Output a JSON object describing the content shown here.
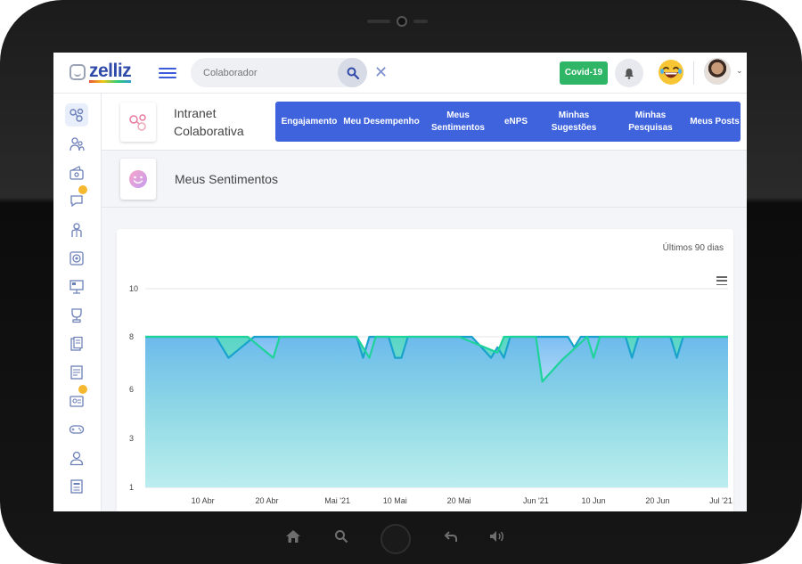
{
  "header": {
    "logo_text": "zelliz",
    "search_placeholder": "Colaborador",
    "covid_label": "Covid-19"
  },
  "app": {
    "title": "Intranet Colaborativa",
    "nav": [
      {
        "label": "Engajamento"
      },
      {
        "label": "Meu Desempenho"
      },
      {
        "label": "Meus Sentimentos"
      },
      {
        "label": "eNPS"
      },
      {
        "label": "Minhas Sugestões"
      },
      {
        "label": "Minhas Pesquisas"
      },
      {
        "label": "Meus Posts"
      }
    ]
  },
  "section": {
    "title": "Meus Sentimentos"
  },
  "sidebar_icons": [
    "network-icon",
    "people-icon",
    "wallet-icon",
    "chat-icon",
    "person-icon",
    "target-icon",
    "presentation-icon",
    "trophy-icon",
    "documents-icon",
    "form-icon",
    "id-card-icon",
    "gamepad-icon",
    "user-icon",
    "report-icon"
  ],
  "chart_data": {
    "type": "area",
    "period_label": "Últimos 90 dias",
    "x_ticks": [
      "10 Abr",
      "20 Abr",
      "Mai '21",
      "10 Mai",
      "20 Mai",
      "Jun '21",
      "10 Jun",
      "20 Jun",
      "Jul '21"
    ],
    "y_ticks": [
      "10",
      "8",
      "6",
      "3",
      "1"
    ],
    "ylim": [
      1,
      10
    ],
    "series": [
      {
        "color": "#19a3cc",
        "dates": [
          "2021-04-01",
          "2021-04-12",
          "2021-04-14",
          "2021-04-16",
          "2021-04-18",
          "2021-04-20",
          "2021-05-04",
          "2021-05-05",
          "2021-05-06",
          "2021-05-09",
          "2021-05-10",
          "2021-05-11",
          "2021-05-12",
          "2021-05-22",
          "2021-05-25",
          "2021-05-26",
          "2021-05-27",
          "2021-05-28",
          "2021-06-06",
          "2021-06-07",
          "2021-06-08",
          "2021-06-15",
          "2021-06-16",
          "2021-06-17",
          "2021-06-22",
          "2021-06-23",
          "2021-06-24",
          "2021-07-01"
        ],
        "values": [
          8,
          8,
          7.2,
          7.6,
          8,
          8,
          8,
          7.2,
          8,
          8,
          7.2,
          7.2,
          8,
          8,
          7.2,
          7.6,
          7.2,
          8,
          8,
          7.6,
          8,
          8,
          7.2,
          8,
          8,
          7.2,
          8,
          8
        ]
      },
      {
        "color": "#1ed39a",
        "dates": [
          "2021-04-01",
          "2021-04-17",
          "2021-04-21",
          "2021-04-22",
          "2021-05-04",
          "2021-05-06",
          "2021-05-07",
          "2021-05-20",
          "2021-05-26",
          "2021-05-27",
          "2021-06-01",
          "2021-06-02",
          "2021-06-05",
          "2021-06-09",
          "2021-06-10",
          "2021-06-11",
          "2021-07-01"
        ],
        "values": [
          8,
          8,
          7.2,
          8,
          8,
          7.2,
          8,
          8,
          7.4,
          8,
          8,
          6.3,
          7.1,
          8,
          7.2,
          8,
          8
        ]
      }
    ]
  }
}
